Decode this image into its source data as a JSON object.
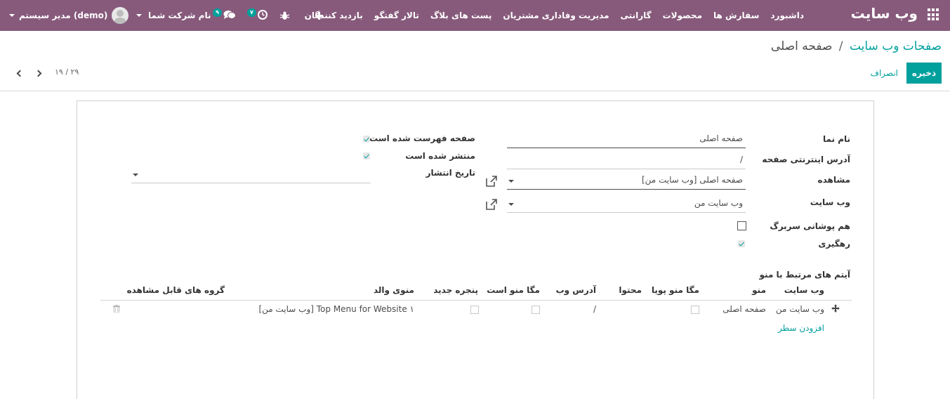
{
  "navbar": {
    "brand": "وب سایت",
    "menu": [
      "داشبورد",
      "سفارش ها",
      "محصولات",
      "گارانتی",
      "مدیریت وفاداری مشتریان",
      "پست های بلاگ",
      "تالار گفتگو",
      "بازدید کنندگان"
    ],
    "add_icon": "plus-icon",
    "debug_icon": "bug-icon",
    "activity_badge": "۷",
    "messages_badge": "۹",
    "company": "نام شرکت شما",
    "user": "مدیر سیستم (demo)",
    "colors": {
      "bar": "#875a7b",
      "accent": "#00a09d"
    }
  },
  "control": {
    "breadcrumb_parent": "صفحات وب سایت",
    "breadcrumb_sep": "/",
    "breadcrumb_current": "صفحه اصلی",
    "save_label": "ذخیره",
    "discard_label": "انصراف",
    "pager": "۱۹ / ۲۹"
  },
  "form": {
    "labels": {
      "name": "نام نما",
      "url": "آدرس اینترنتی صفحه",
      "view": "مشاهده",
      "website": "وب سایت",
      "header_overlay": "هم پوشانی سربرگ",
      "tracking": "رهگیری",
      "indexed": "صفحه فهرست شده است",
      "published": "منتشر شده است",
      "publish_date": "تاریخ انتشار"
    },
    "values": {
      "name": "صفحه اصلی",
      "url": "/",
      "view": "صفحه اصلی [وب سایت من]",
      "website": "وب سایت من",
      "publish_date": ""
    },
    "checks": {
      "header_overlay": false,
      "tracking": true,
      "indexed": true,
      "published": true
    }
  },
  "menus": {
    "section_title": "آیتم های مرتبط با منو",
    "columns": [
      "وب سایت",
      "منو",
      "مگا منو پویا",
      "محتوا",
      "آدرس وب",
      "مگا منو است",
      "پنجره جدید",
      "منوی والد",
      "گروه های قابل مشاهده"
    ],
    "rows": [
      {
        "website": "وب سایت من",
        "menu": "صفحه اصلی",
        "dynamic_mega": false,
        "content": "",
        "url": "/",
        "is_mega": false,
        "new_window": false,
        "parent": "Top Menu for Website ۱ [وب سایت من]",
        "groups": ""
      }
    ],
    "add_line": "افزودن سطر"
  }
}
